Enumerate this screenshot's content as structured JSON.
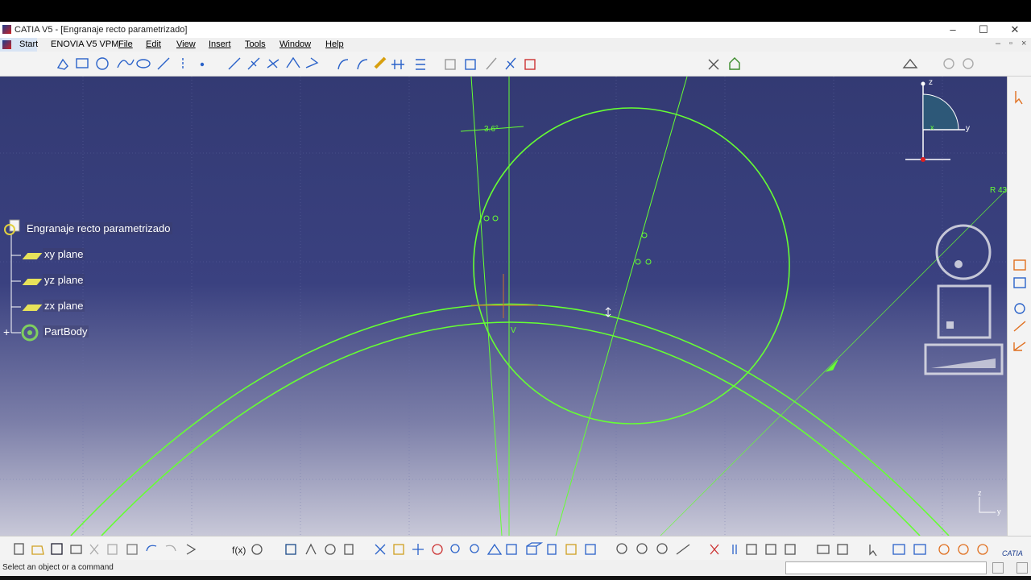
{
  "window": {
    "title": "CATIA V5 - [Engranaje recto parametrizado]",
    "minimize": "–",
    "maximize": "☐",
    "close": "✕"
  },
  "menu": {
    "start": "Start",
    "items": [
      "ENOVIA V5 VPM",
      "File",
      "Edit",
      "View",
      "Insert",
      "Tools",
      "Window",
      "Help"
    ],
    "doc_controls": [
      "–",
      "▫",
      "×"
    ]
  },
  "tree": {
    "root": "Engranaje recto parametrizado",
    "items": [
      {
        "label": "xy plane",
        "icon": "plane-icon"
      },
      {
        "label": "yz plane",
        "icon": "plane-icon"
      },
      {
        "label": "zx plane",
        "icon": "plane-icon"
      },
      {
        "label": "PartBody",
        "icon": "partbody-icon"
      }
    ]
  },
  "sketch": {
    "angle_label": "3.6°",
    "radius_label": "R 43",
    "v_label": "V"
  },
  "compass": {
    "z": "z",
    "y": "y",
    "x": "x"
  },
  "mini_axis": {
    "z": "z",
    "y": "y"
  },
  "status": {
    "message": "Select an object or a command",
    "command_value": ""
  },
  "colors": {
    "sketch_green": "#66ff33",
    "background_top": "#333a73",
    "background_bottom": "#c8c8d8"
  }
}
